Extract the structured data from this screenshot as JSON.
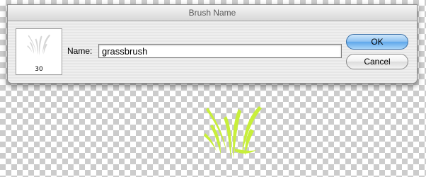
{
  "dialog": {
    "title": "Brush Name",
    "preview_size": "30",
    "name_label": "Name:",
    "name_value": "grassbrush",
    "ok_label": "OK",
    "cancel_label": "Cancel"
  },
  "canvas": {
    "brush_icon": "grass-brush-stroke",
    "brush_color": "#c8ef3a"
  }
}
